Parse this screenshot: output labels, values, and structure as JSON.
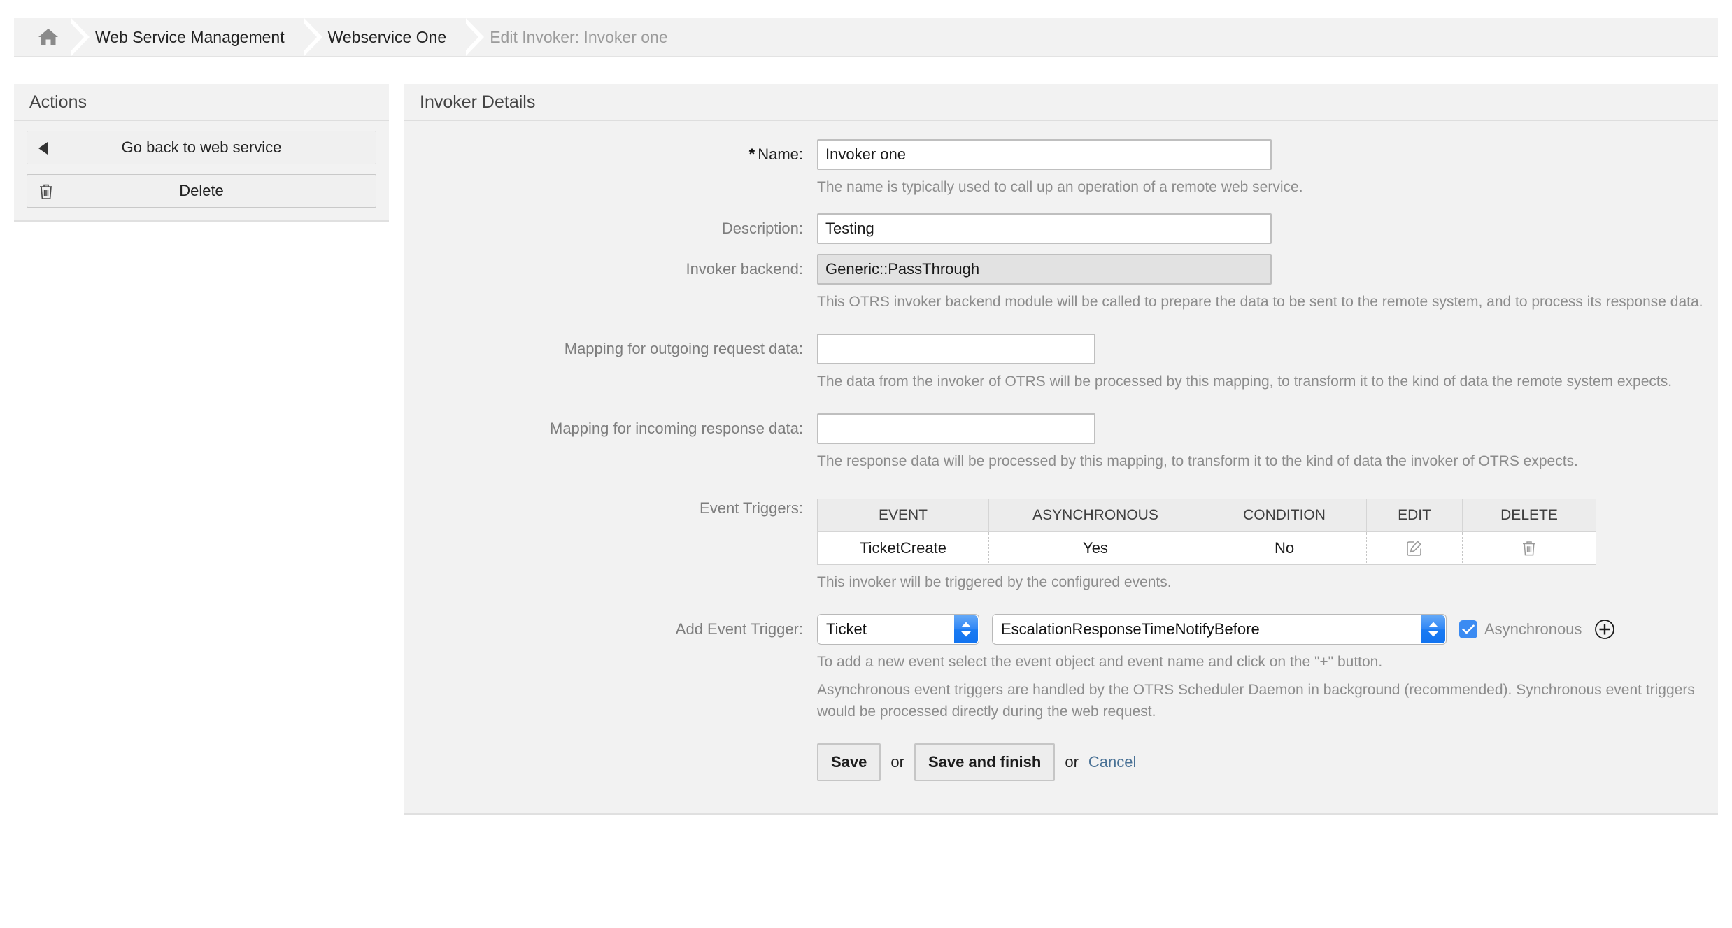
{
  "breadcrumb": {
    "home_icon": "home-icon",
    "items": [
      {
        "label": "Web Service Management"
      },
      {
        "label": "Webservice One"
      },
      {
        "label": "Edit Invoker: Invoker one"
      }
    ]
  },
  "sidebar": {
    "title": "Actions",
    "items": [
      {
        "label": "Go back to web service",
        "icon": "caret-left-icon"
      },
      {
        "label": "Delete",
        "icon": "trash-icon"
      }
    ]
  },
  "main": {
    "title": "Invoker Details",
    "name": {
      "star": "*",
      "label": "Name:",
      "value": "Invoker one",
      "hint": "The name is typically used to call up an operation of a remote web service."
    },
    "description": {
      "label": "Description:",
      "value": "Testing"
    },
    "backend": {
      "label": "Invoker backend:",
      "value": "Generic::PassThrough",
      "hint": "This OTRS invoker backend module will be called to prepare the data to be sent to the remote system, and to process its response data."
    },
    "mapping_outgoing": {
      "label": "Mapping for outgoing request data:",
      "value": "",
      "hint": "The data from the invoker of OTRS will be processed by this mapping, to transform it to the kind of data the remote system expects."
    },
    "mapping_incoming": {
      "label": "Mapping for incoming response data:",
      "value": "",
      "hint": "The response data will be processed by this mapping, to transform it to the kind of data the invoker of OTRS expects."
    },
    "event_triggers": {
      "label": "Event Triggers:",
      "columns": [
        "EVENT",
        "ASYNCHRONOUS",
        "CONDITION",
        "EDIT",
        "DELETE"
      ],
      "rows": [
        {
          "event": "TicketCreate",
          "asynchronous": "Yes",
          "condition": "No",
          "edit_icon": "edit-pencil-icon",
          "delete_icon": "trash-icon"
        }
      ],
      "hint": "This invoker will be triggered by the configured events."
    },
    "add_event_trigger": {
      "label": "Add Event Trigger:",
      "object_value": "Ticket",
      "event_value": "EscalationResponseTimeNotifyBefore",
      "async_label": "Asynchronous",
      "async_checked": true,
      "add_icon": "plus-circle-icon",
      "hint1": "To add a new event select the event object and event name and click on the \"+\" button.",
      "hint2": "Asynchronous event triggers are handled by the OTRS Scheduler Daemon in background (recommended). Synchronous event triggers would be processed directly during the web request."
    },
    "submit": {
      "save_label": "Save",
      "or_1": "or",
      "save_finish_label": "Save and finish",
      "or_2": "or",
      "cancel_label": "Cancel"
    }
  },
  "colors": {
    "accent_blue": "#3b8bf2",
    "link_blue": "#4a7296",
    "panel_bg": "#f2f2f2",
    "hint_gray": "#8c8c8c"
  }
}
